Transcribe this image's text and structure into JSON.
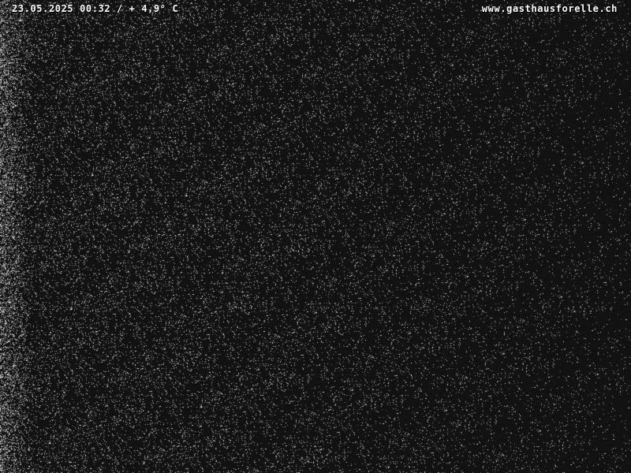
{
  "overlay": {
    "timestamp_temperature": "23.05.2025 00:32 / + 4,9° C",
    "website": "www.gasthausforelle.ch"
  },
  "colors": {
    "background": "#121212",
    "noise": "#e6e6e6",
    "overlay_text": "#ffffff"
  }
}
